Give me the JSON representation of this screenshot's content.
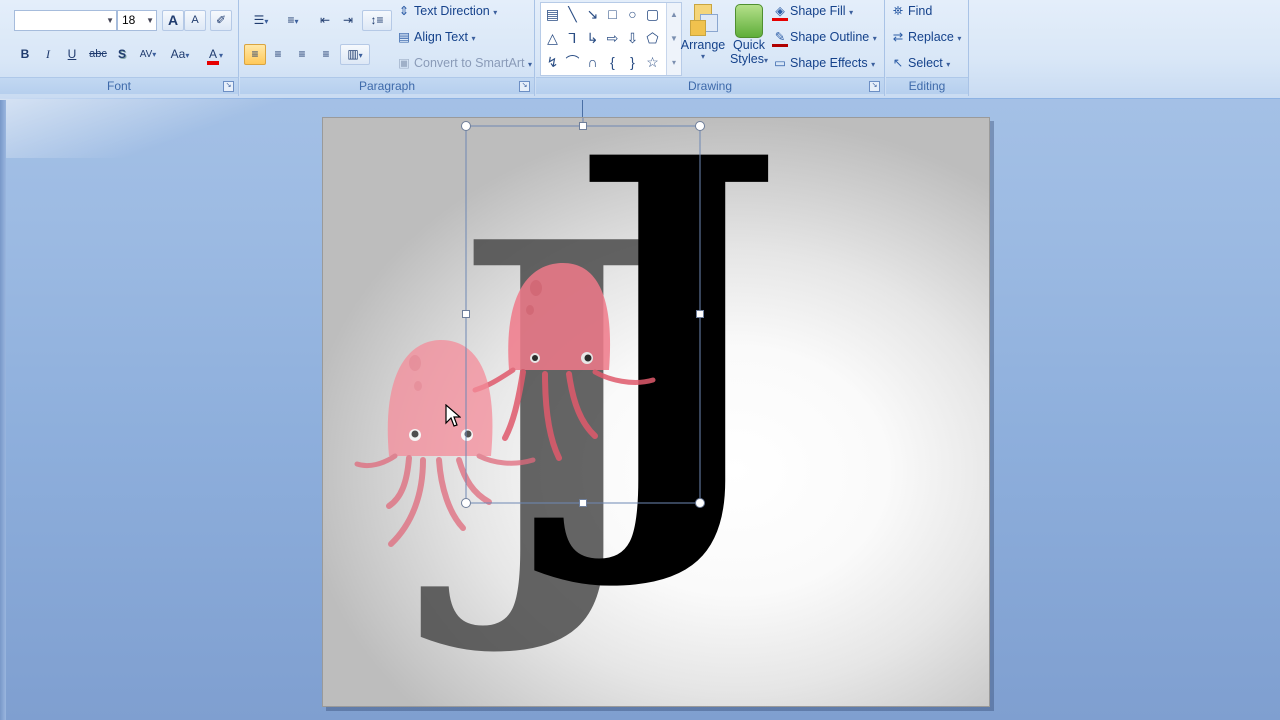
{
  "font": {
    "group_label": "Font",
    "font_name": "",
    "font_size": "18",
    "grow_icon": "A",
    "shrink_icon": "A",
    "clear_icon": "✐",
    "bold": "B",
    "italic": "I",
    "underline": "U",
    "strike": "abc",
    "shadow": "S",
    "spacing": "AV",
    "case": "Aa",
    "color": "A",
    "color_hex": "#e60000"
  },
  "paragraph": {
    "group_label": "Paragraph",
    "text_direction": "Text Direction",
    "align_text": "Align Text",
    "convert_smartart": "Convert to SmartArt"
  },
  "drawing": {
    "group_label": "Drawing",
    "arrange": "Arrange",
    "quick_styles_1": "Quick",
    "quick_styles_2": "Styles",
    "shape_fill": "Shape Fill",
    "shape_outline": "Shape Outline",
    "shape_effects": "Shape Effects"
  },
  "editing": {
    "group_label": "Editing",
    "find": "Find",
    "replace": "Replace",
    "select": "Select"
  },
  "slide": {
    "letter_back": "J",
    "letter_front": "J",
    "back_color": "#4a4a4a",
    "front_color": "#000000",
    "octopus_color": "#f07a8a"
  }
}
